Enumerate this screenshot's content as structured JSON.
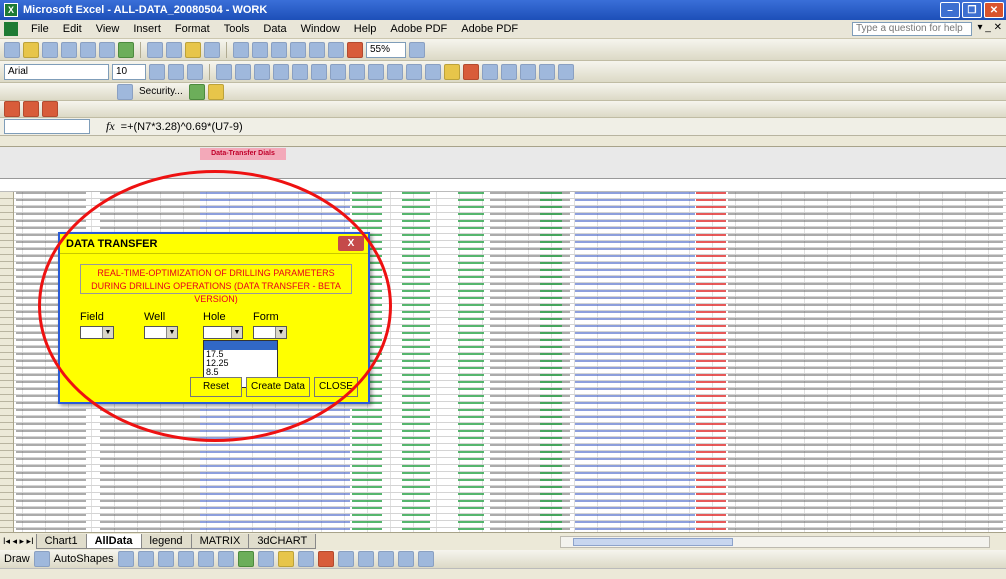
{
  "window": {
    "title": "Microsoft Excel - ALL-DATA_20080504 - WORK",
    "app_icon": "X"
  },
  "menu": {
    "items": [
      "File",
      "Edit",
      "View",
      "Insert",
      "Format",
      "Tools",
      "Data",
      "Window",
      "Help",
      "Adobe PDF",
      "Adobe PDF"
    ],
    "help_placeholder": "Type a question for help"
  },
  "toolbar": {
    "zoom": "55%",
    "font_name": "Arial",
    "font_size": "10",
    "security_label": "Security..."
  },
  "formula_bar": {
    "name_box": "",
    "fx": "fx",
    "formula": "=+(N7*3.28)^0.69*(U7-9)"
  },
  "sheet": {
    "title_band": "Data-Transfer Dials"
  },
  "dialog": {
    "title": "DATA TRANSFER",
    "close": "X",
    "heading": "REAL-TIME-OPTIMIZATION OF DRILLING PARAMETERS DURING DRILLING OPERATIONS (DATA TRANSFER - BETA VERSION)",
    "labels": {
      "field": "Field",
      "well": "Well",
      "hole": "Hole",
      "form": "Form"
    },
    "hole_options": [
      "",
      "17.5",
      "12.25",
      "8.5"
    ],
    "buttons": {
      "reset": "Reset",
      "create": "Create Data",
      "close": "CLOSE"
    }
  },
  "tabs": {
    "nav": "I◂ ◂ ▸ ▸I",
    "items": [
      "Chart1",
      "AllData",
      "legend",
      "MATRIX",
      "3dCHART"
    ],
    "active": "AllData"
  },
  "drawbar": {
    "draw": "Draw",
    "autoshapes": "AutoShapes"
  },
  "colors": {
    "accent": "#ffff00",
    "highlight": "#ee1111",
    "title_bar": "#2a5bd7"
  }
}
